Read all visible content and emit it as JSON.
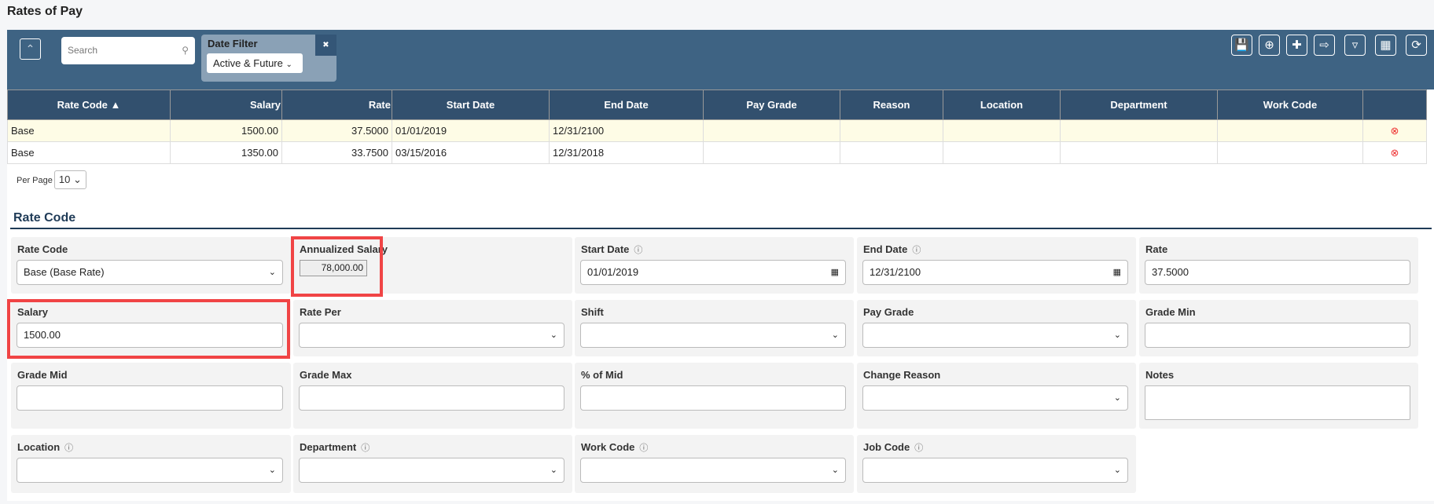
{
  "page_title": "Rates of Pay",
  "toolbar": {
    "search_placeholder": "Search",
    "date_filter_label": "Date Filter",
    "date_filter_value": "Active & Future",
    "buttons": [
      "save-icon",
      "add-icon",
      "add-layer-icon",
      "export-icon",
      "filter-icon",
      "grid-icon",
      "refresh-icon"
    ]
  },
  "table": {
    "columns": [
      "Rate Code ▲",
      "Salary",
      "Rate",
      "Start Date",
      "End Date",
      "Pay Grade",
      "Reason",
      "Location",
      "Department",
      "Work Code",
      ""
    ],
    "rows": [
      [
        "Base",
        "1500.00",
        "37.5000",
        "01/01/2019",
        "12/31/2100",
        "",
        "",
        "",
        "",
        ""
      ],
      [
        "Base",
        "1350.00",
        "33.7500",
        "03/15/2016",
        "12/31/2018",
        "",
        "",
        "",
        "",
        ""
      ]
    ]
  },
  "per_page": {
    "label": "Per Page",
    "value": "10"
  },
  "section_title": "Rate Code",
  "form": {
    "rate_code": {
      "label": "Rate Code",
      "value": "Base (Base Rate)"
    },
    "annualized_salary": {
      "label": "Annualized Salary",
      "value": "78,000.00"
    },
    "start_date": {
      "label": "Start Date",
      "value": "01/01/2019"
    },
    "end_date": {
      "label": "End Date",
      "value": "12/31/2100"
    },
    "rate": {
      "label": "Rate",
      "value": "37.5000"
    },
    "salary": {
      "label": "Salary",
      "value": "1500.00"
    },
    "rate_per": {
      "label": "Rate Per",
      "value": ""
    },
    "shift": {
      "label": "Shift",
      "value": ""
    },
    "pay_grade": {
      "label": "Pay Grade",
      "value": ""
    },
    "grade_min": {
      "label": "Grade Min",
      "value": ""
    },
    "grade_mid": {
      "label": "Grade Mid",
      "value": ""
    },
    "grade_max": {
      "label": "Grade Max",
      "value": ""
    },
    "pct_mid": {
      "label": "% of Mid",
      "value": ""
    },
    "change_reason": {
      "label": "Change Reason",
      "value": ""
    },
    "notes": {
      "label": "Notes",
      "value": ""
    },
    "location": {
      "label": "Location",
      "value": ""
    },
    "department": {
      "label": "Department",
      "value": ""
    },
    "work_code": {
      "label": "Work Code",
      "value": ""
    },
    "job_code": {
      "label": "Job Code",
      "value": ""
    }
  },
  "colors": {
    "toolbar": "#3e6383",
    "header": "#32506e",
    "highlight": "#f04445",
    "selected_row": "#fefce6"
  }
}
